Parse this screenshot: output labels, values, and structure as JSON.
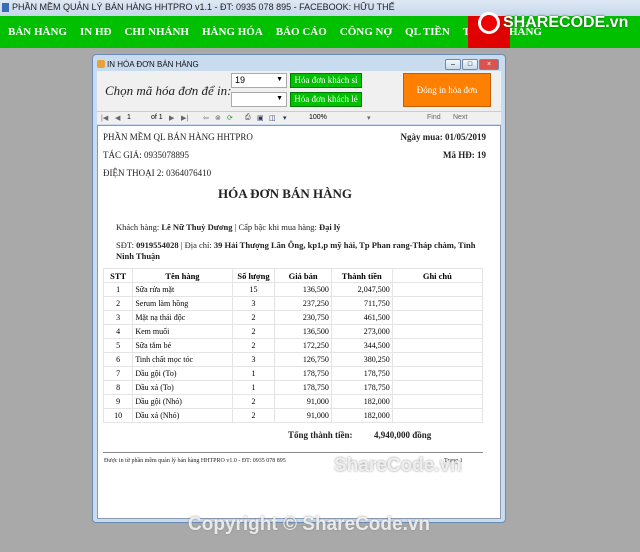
{
  "app": {
    "title": "PHẦN MỀM QUẢN LÝ BÁN HÀNG HHTPRO v1.1 - ĐT: 0935 078 895 - FACEBOOK: HỮU THẾ",
    "menu": [
      "BÁN HÀNG",
      "IN HĐ",
      "CHI NHÁNH",
      "HÀNG HÓA",
      "BÁO CÁO",
      "CÔNG NỢ",
      "QL TIỀN",
      "TT. CỬA HÀNG"
    ],
    "accent": "#00c000"
  },
  "logo": "SHARECODE.vn",
  "dialog": {
    "title": "IN HÓA ĐƠN BÁN HÀNG",
    "prompt": "Chọn mã hóa đơn để in:",
    "invoice_select": "19",
    "second_select": "",
    "btn_wholesale": "Hóa đơn khách sỉ",
    "btn_retail": "Hóa đơn khách lẻ",
    "btn_close": "Đóng in hóa đơn"
  },
  "toolbar": {
    "page": "1",
    "of": "of 1",
    "zoom": "100%",
    "find": "Find",
    "next": "Next"
  },
  "report": {
    "company": "PHẦN MỀM QL BÁN HÀNG HHTPRO",
    "author": "TÁC GIẢ: 0935078895",
    "phone2": "ĐIỆN THOẠI 2: 0364076410",
    "date_label": "Ngày mua: 01/05/2019",
    "code_label": "Mã HĐ: 19",
    "heading": "HÓA ĐƠN BÁN HÀNG",
    "customer_label": "Khách hàng:",
    "customer": "Lê Nữ Thuỳ Dương",
    "level_label": "| Cấp bậc khi mua hàng:",
    "level": "Đại lý",
    "phone_label": "SĐT:",
    "phone": "0919554028",
    "addr_label": "| Địa chỉ:",
    "address": "39 Hải Thượng Lãn Ông, kp1,p mỹ hải, Tp Phan rang-Tháp chàm, Tỉnh Ninh Thuận",
    "columns": [
      "STT",
      "Tên hàng",
      "Số lượng",
      "Giá bán",
      "Thành tiền",
      "Ghi chú"
    ],
    "rows": [
      [
        "1",
        "Sữa rửa mặt",
        "15",
        "136,500",
        "2,047,500",
        ""
      ],
      [
        "2",
        "Serum làm hồng",
        "3",
        "237,250",
        "711,750",
        ""
      ],
      [
        "3",
        "Mặt nạ thải độc",
        "2",
        "230,750",
        "461,500",
        ""
      ],
      [
        "4",
        "Kem muối",
        "2",
        "136,500",
        "273,000",
        ""
      ],
      [
        "5",
        "Sữa tắm bé",
        "2",
        "172,250",
        "344,500",
        ""
      ],
      [
        "6",
        "Tinh chất mọc tóc",
        "3",
        "126,750",
        "380,250",
        ""
      ],
      [
        "7",
        "Dầu gội (To)",
        "1",
        "178,750",
        "178,750",
        ""
      ],
      [
        "8",
        "Dầu xả (To)",
        "1",
        "178,750",
        "178,750",
        ""
      ],
      [
        "9",
        "Dầu gội (Nhỏ)",
        "2",
        "91,000",
        "182,000",
        ""
      ],
      [
        "10",
        "Dầu xả (Nhỏ)",
        "2",
        "91,000",
        "182,000",
        ""
      ]
    ],
    "total_label": "Tổng thành tiền:",
    "total": "4,940,000 đồng",
    "footer": "Được in từ phần mềm quản lý bán hàng HHTPRO v1.0 - ĐT: 0935 078 895",
    "page_label": "Trang 1"
  },
  "watermarks": [
    "ShareCode.vn",
    "Copyright © ShareCode.vn"
  ]
}
